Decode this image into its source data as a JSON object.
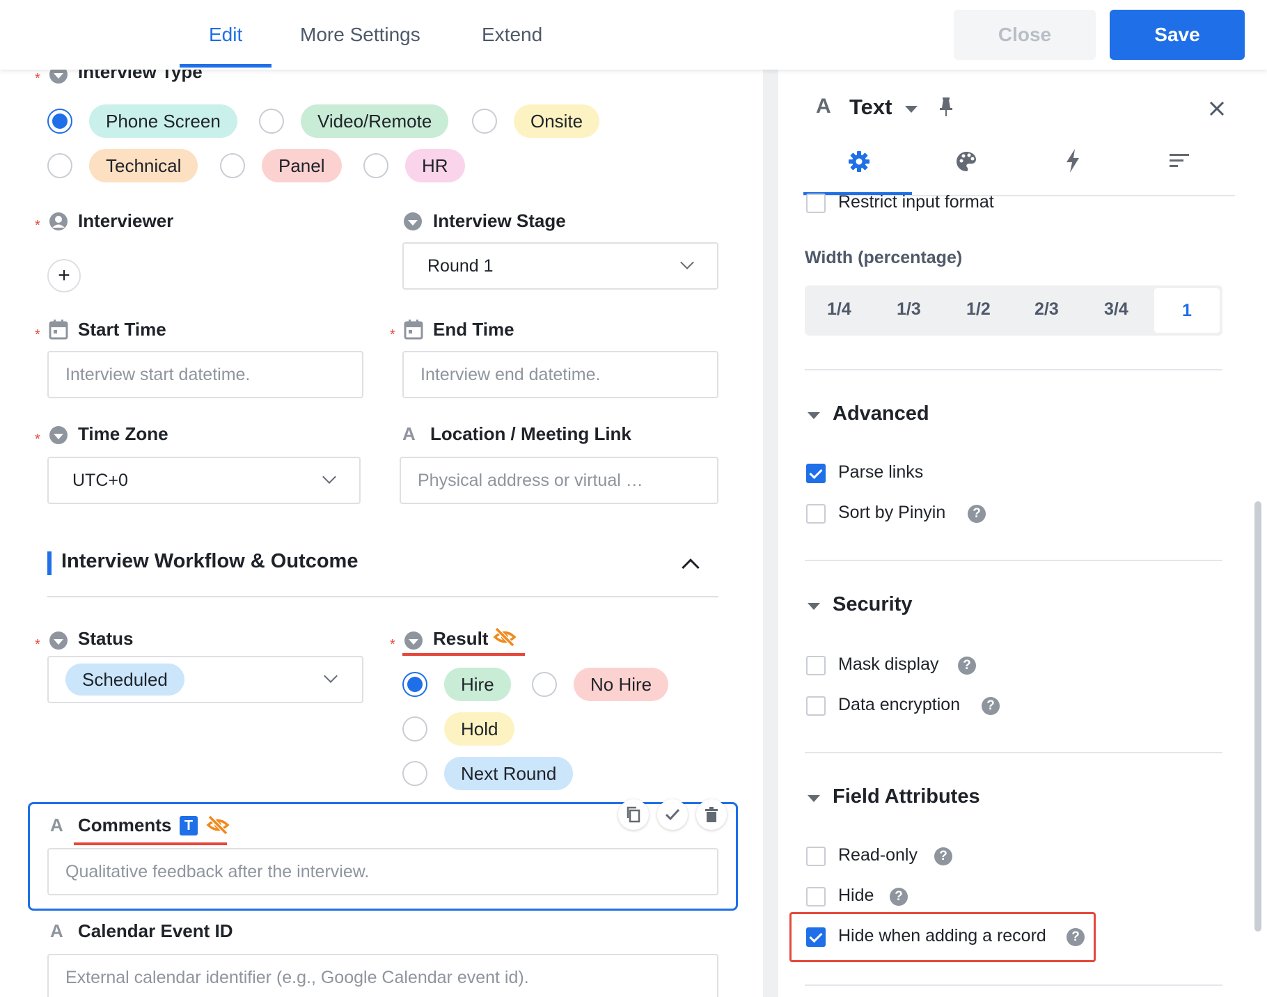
{
  "header": {
    "tabs": [
      {
        "label": "Edit",
        "active": true
      },
      {
        "label": "More Settings",
        "active": false
      },
      {
        "label": "Extend",
        "active": false
      }
    ],
    "close_label": "Close",
    "save_label": "Save"
  },
  "form": {
    "required_mark": "*",
    "interview_type": {
      "label": "Interview Type",
      "options": [
        {
          "label": "Phone Screen",
          "checked": true,
          "color": "#c9f0ea"
        },
        {
          "label": "Video/Remote",
          "checked": false,
          "color": "#c8ecd6"
        },
        {
          "label": "Onsite",
          "checked": false,
          "color": "#fdf3c2"
        },
        {
          "label": "Technical",
          "checked": false,
          "color": "#fde0c2"
        },
        {
          "label": "Panel",
          "checked": false,
          "color": "#fcd2d0"
        },
        {
          "label": "HR",
          "checked": false,
          "color": "#fad4ea"
        }
      ]
    },
    "interviewer": {
      "label": "Interviewer",
      "add_symbol": "+"
    },
    "interview_stage": {
      "label": "Interview Stage",
      "value": "Round 1"
    },
    "start_time": {
      "label": "Start Time",
      "placeholder": "Interview start datetime."
    },
    "end_time": {
      "label": "End Time",
      "placeholder": "Interview end datetime."
    },
    "time_zone": {
      "label": "Time Zone",
      "value": "UTC+0"
    },
    "location": {
      "label": "Location / Meeting Link",
      "placeholder": "Physical address or virtual …",
      "icon_glyph": "A"
    },
    "section_title": "Interview Workflow & Outcome",
    "status": {
      "label": "Status",
      "value": "Scheduled",
      "value_color": "#cbe5fb"
    },
    "result": {
      "label": "Result",
      "options": [
        {
          "label": "Hire",
          "checked": true,
          "color": "#c8ecd6"
        },
        {
          "label": "No Hire",
          "checked": false,
          "color": "#fcd2d0"
        },
        {
          "label": "Hold",
          "checked": false,
          "color": "#fdf3c2"
        },
        {
          "label": "Next Round",
          "checked": false,
          "color": "#cbe5fb"
        }
      ]
    },
    "comments": {
      "label": "Comments",
      "badge": "T",
      "placeholder": "Qualitative feedback after the interview.",
      "icon_glyph": "A"
    },
    "calendar_event_id": {
      "label": "Calendar Event ID",
      "placeholder": "External calendar identifier (e.g., Google Calendar event id).",
      "icon_glyph": "A"
    }
  },
  "panel": {
    "type_glyph": "A",
    "type_label": "Text",
    "restrict_input_format": "Restrict input format",
    "width_label": "Width (percentage)",
    "width_options": [
      "1/4",
      "1/3",
      "1/2",
      "2/3",
      "3/4",
      "1"
    ],
    "width_selected": "1",
    "advanced": {
      "title": "Advanced",
      "items": [
        {
          "label": "Parse links",
          "checked": true,
          "help": false
        },
        {
          "label": "Sort by Pinyin",
          "checked": false,
          "help": true
        }
      ]
    },
    "security": {
      "title": "Security",
      "items": [
        {
          "label": "Mask display",
          "checked": false,
          "help": true
        },
        {
          "label": "Data encryption",
          "checked": false,
          "help": true
        }
      ]
    },
    "field_attributes": {
      "title": "Field Attributes",
      "items": [
        {
          "label": "Read-only",
          "checked": false,
          "help": true
        },
        {
          "label": "Hide",
          "checked": false,
          "help": true
        },
        {
          "label": "Hide when adding a record",
          "checked": true,
          "help": true
        }
      ]
    },
    "help_glyph": "?"
  },
  "colors": {
    "accent": "#1e6fe8",
    "danger": "#e5483a",
    "hidden_icon": "#f08a1c"
  }
}
